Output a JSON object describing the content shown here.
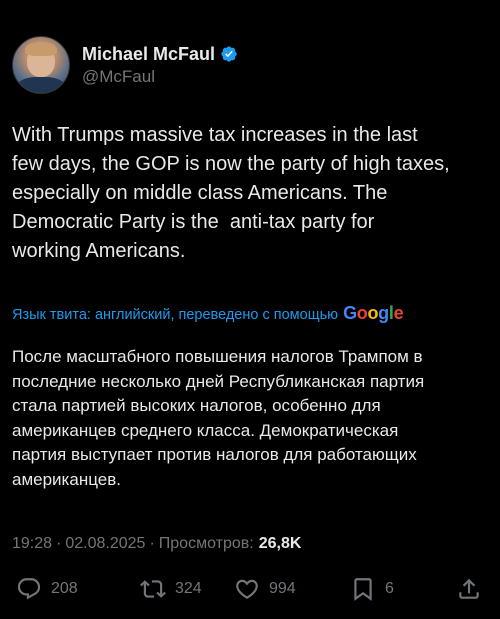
{
  "author": {
    "display_name": "Michael McFaul",
    "handle": "@McFaul",
    "verified": true,
    "avatar_icon": "user-avatar-photo"
  },
  "tweet": {
    "text": "With Trumps massive tax increases in the last\nfew days, the GOP is now the party of high taxes,\nespecially on middle class Americans. The\nDemocratic Party is the  anti-tax party for\nworking Americans.",
    "translate_note": "Язык твита: английский, переведено с помощью",
    "translate_provider": "Google",
    "translated_text": "После масштабного повышения налогов Трампом в\nпоследние несколько дней Республиканская партия\nстала партией высоких налогов, особенно для\nамериканцев среднего класса. Демократическая\nпартия выступает против налогов для работающих\nамериканцев."
  },
  "meta": {
    "time": "19:28",
    "date": "02.08.2025",
    "views_label": "Просмотров:",
    "views_count": "26,8K",
    "separator": "·"
  },
  "actions": {
    "replies": "208",
    "reposts": "324",
    "likes": "994",
    "bookmarks": "6"
  },
  "colors": {
    "background": "#000000",
    "text": "#e7e9ea",
    "muted": "#71767b",
    "link": "#1d9bf0",
    "verified": "#1d9bf0"
  }
}
